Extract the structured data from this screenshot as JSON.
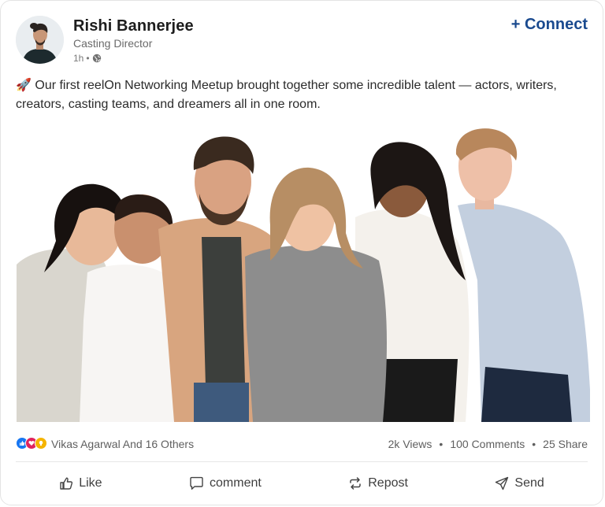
{
  "post": {
    "author_name": "Rishi Bannerjee",
    "author_role": "Casting Director",
    "time": "1h",
    "meta_separator": "•",
    "connect_label": "+ Connect",
    "text": "🚀 Our first reelOn Networking Meetup brought together some incredible talent — actors, writers, creators, casting teams, and dreamers all in one room."
  },
  "stats": {
    "reactors": "Vikas Agarwal And 16 Others",
    "views": "2k Views",
    "comments": "100 Comments",
    "shares": "25 Share",
    "separator": "•"
  },
  "actions": {
    "like": "Like",
    "comment": "comment",
    "repost": "Repost",
    "send": "Send"
  },
  "colors": {
    "accent": "#1a4a8f",
    "like_reaction": "#1877f2",
    "love_reaction": "#e0245e",
    "idea_reaction": "#f5b400"
  },
  "icons": {
    "reactions": [
      "like-reaction-icon",
      "love-reaction-icon",
      "idea-reaction-icon"
    ],
    "visibility": "globe-icon"
  }
}
